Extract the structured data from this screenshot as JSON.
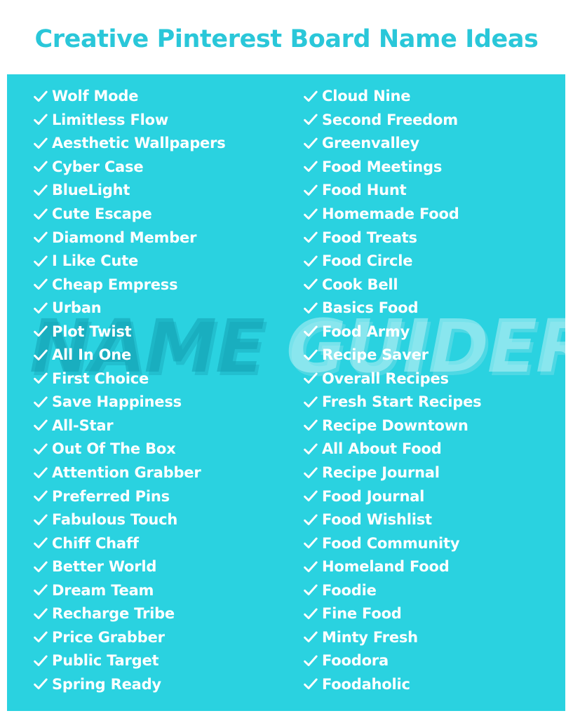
{
  "header": {
    "title": "Creative Pinterest Board Name Ideas",
    "title_color": "#2ac7d9"
  },
  "panel": {
    "background_color": "#2ad2e0",
    "text_color": "#ffffff"
  },
  "watermark": {
    "word_one": "NAME",
    "word_two": "GUIDER"
  },
  "icons": {
    "check": "check-icon"
  },
  "columns": [
    {
      "id": "left-column",
      "items": [
        "Wolf Mode",
        "Limitless Flow",
        "Aesthetic Wallpapers",
        "Cyber Case",
        "BlueLight",
        "Cute Escape",
        "Diamond Member",
        "I Like Cute",
        "Cheap Empress",
        "Urban",
        "Plot Twist",
        "All In One",
        "First Choice",
        "Save Happiness",
        "All-Star",
        "Out Of The Box",
        "Attention Grabber",
        "Preferred Pins",
        "Fabulous Touch",
        "Chiff Chaff",
        "Better World",
        "Dream Team",
        "Recharge Tribe",
        "Price Grabber",
        "Public Target",
        "Spring Ready"
      ]
    },
    {
      "id": "right-column",
      "items": [
        "Cloud Nine",
        "Second Freedom",
        "Greenvalley",
        "Food Meetings",
        "Food Hunt",
        "Homemade Food",
        "Food Treats",
        "Food Circle",
        "Cook Bell",
        "Basics Food",
        "Food Army",
        "Recipe Saver",
        "Overall Recipes",
        "Fresh Start Recipes",
        "Recipe Downtown",
        "All About Food",
        "Recipe Journal",
        "Food Journal",
        "Food Wishlist",
        "Food Community",
        "Homeland Food",
        "Foodie",
        "Fine Food",
        "Minty Fresh",
        "Foodora",
        "Foodaholic"
      ]
    }
  ]
}
